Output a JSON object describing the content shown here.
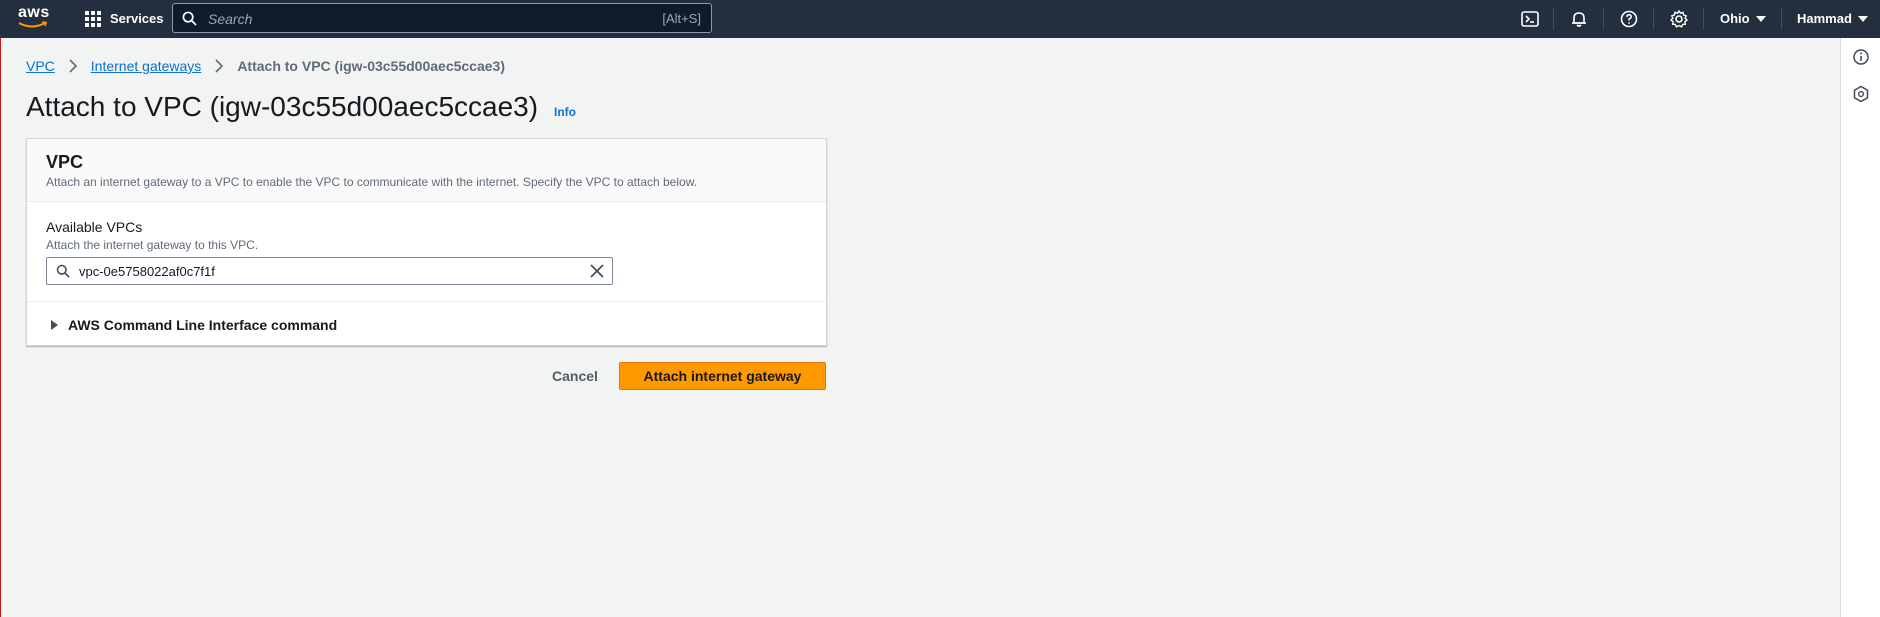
{
  "topbar": {
    "logo_text": "aws",
    "services_label": "Services",
    "search_placeholder": "Search",
    "search_shortcut": "[Alt+S]",
    "region_label": "Ohio",
    "user_label": "Hammad",
    "icons": [
      "cloudshell-icon",
      "bell-icon",
      "help-icon",
      "settings-icon"
    ]
  },
  "breadcrumb": {
    "items": [
      "VPC",
      "Internet gateways"
    ],
    "current": "Attach to VPC (igw-03c55d00aec5ccae3)"
  },
  "page": {
    "title": "Attach to VPC (igw-03c55d00aec5ccae3)",
    "info_label": "Info"
  },
  "panel": {
    "title": "VPC",
    "description": "Attach an internet gateway to a VPC to enable the VPC to communicate with the internet. Specify the VPC to attach below.",
    "field_label": "Available VPCs",
    "field_description": "Attach the internet gateway to this VPC.",
    "field_value": "vpc-0e5758022af0c7f1f",
    "expander_label": "AWS Command Line Interface command"
  },
  "actions": {
    "cancel_label": "Cancel",
    "primary_label": "Attach internet gateway"
  },
  "colors": {
    "nav_bg": "#232f3e",
    "primary": "#ff9900",
    "link": "#0972d3",
    "page_bg": "#f2f3f3"
  }
}
